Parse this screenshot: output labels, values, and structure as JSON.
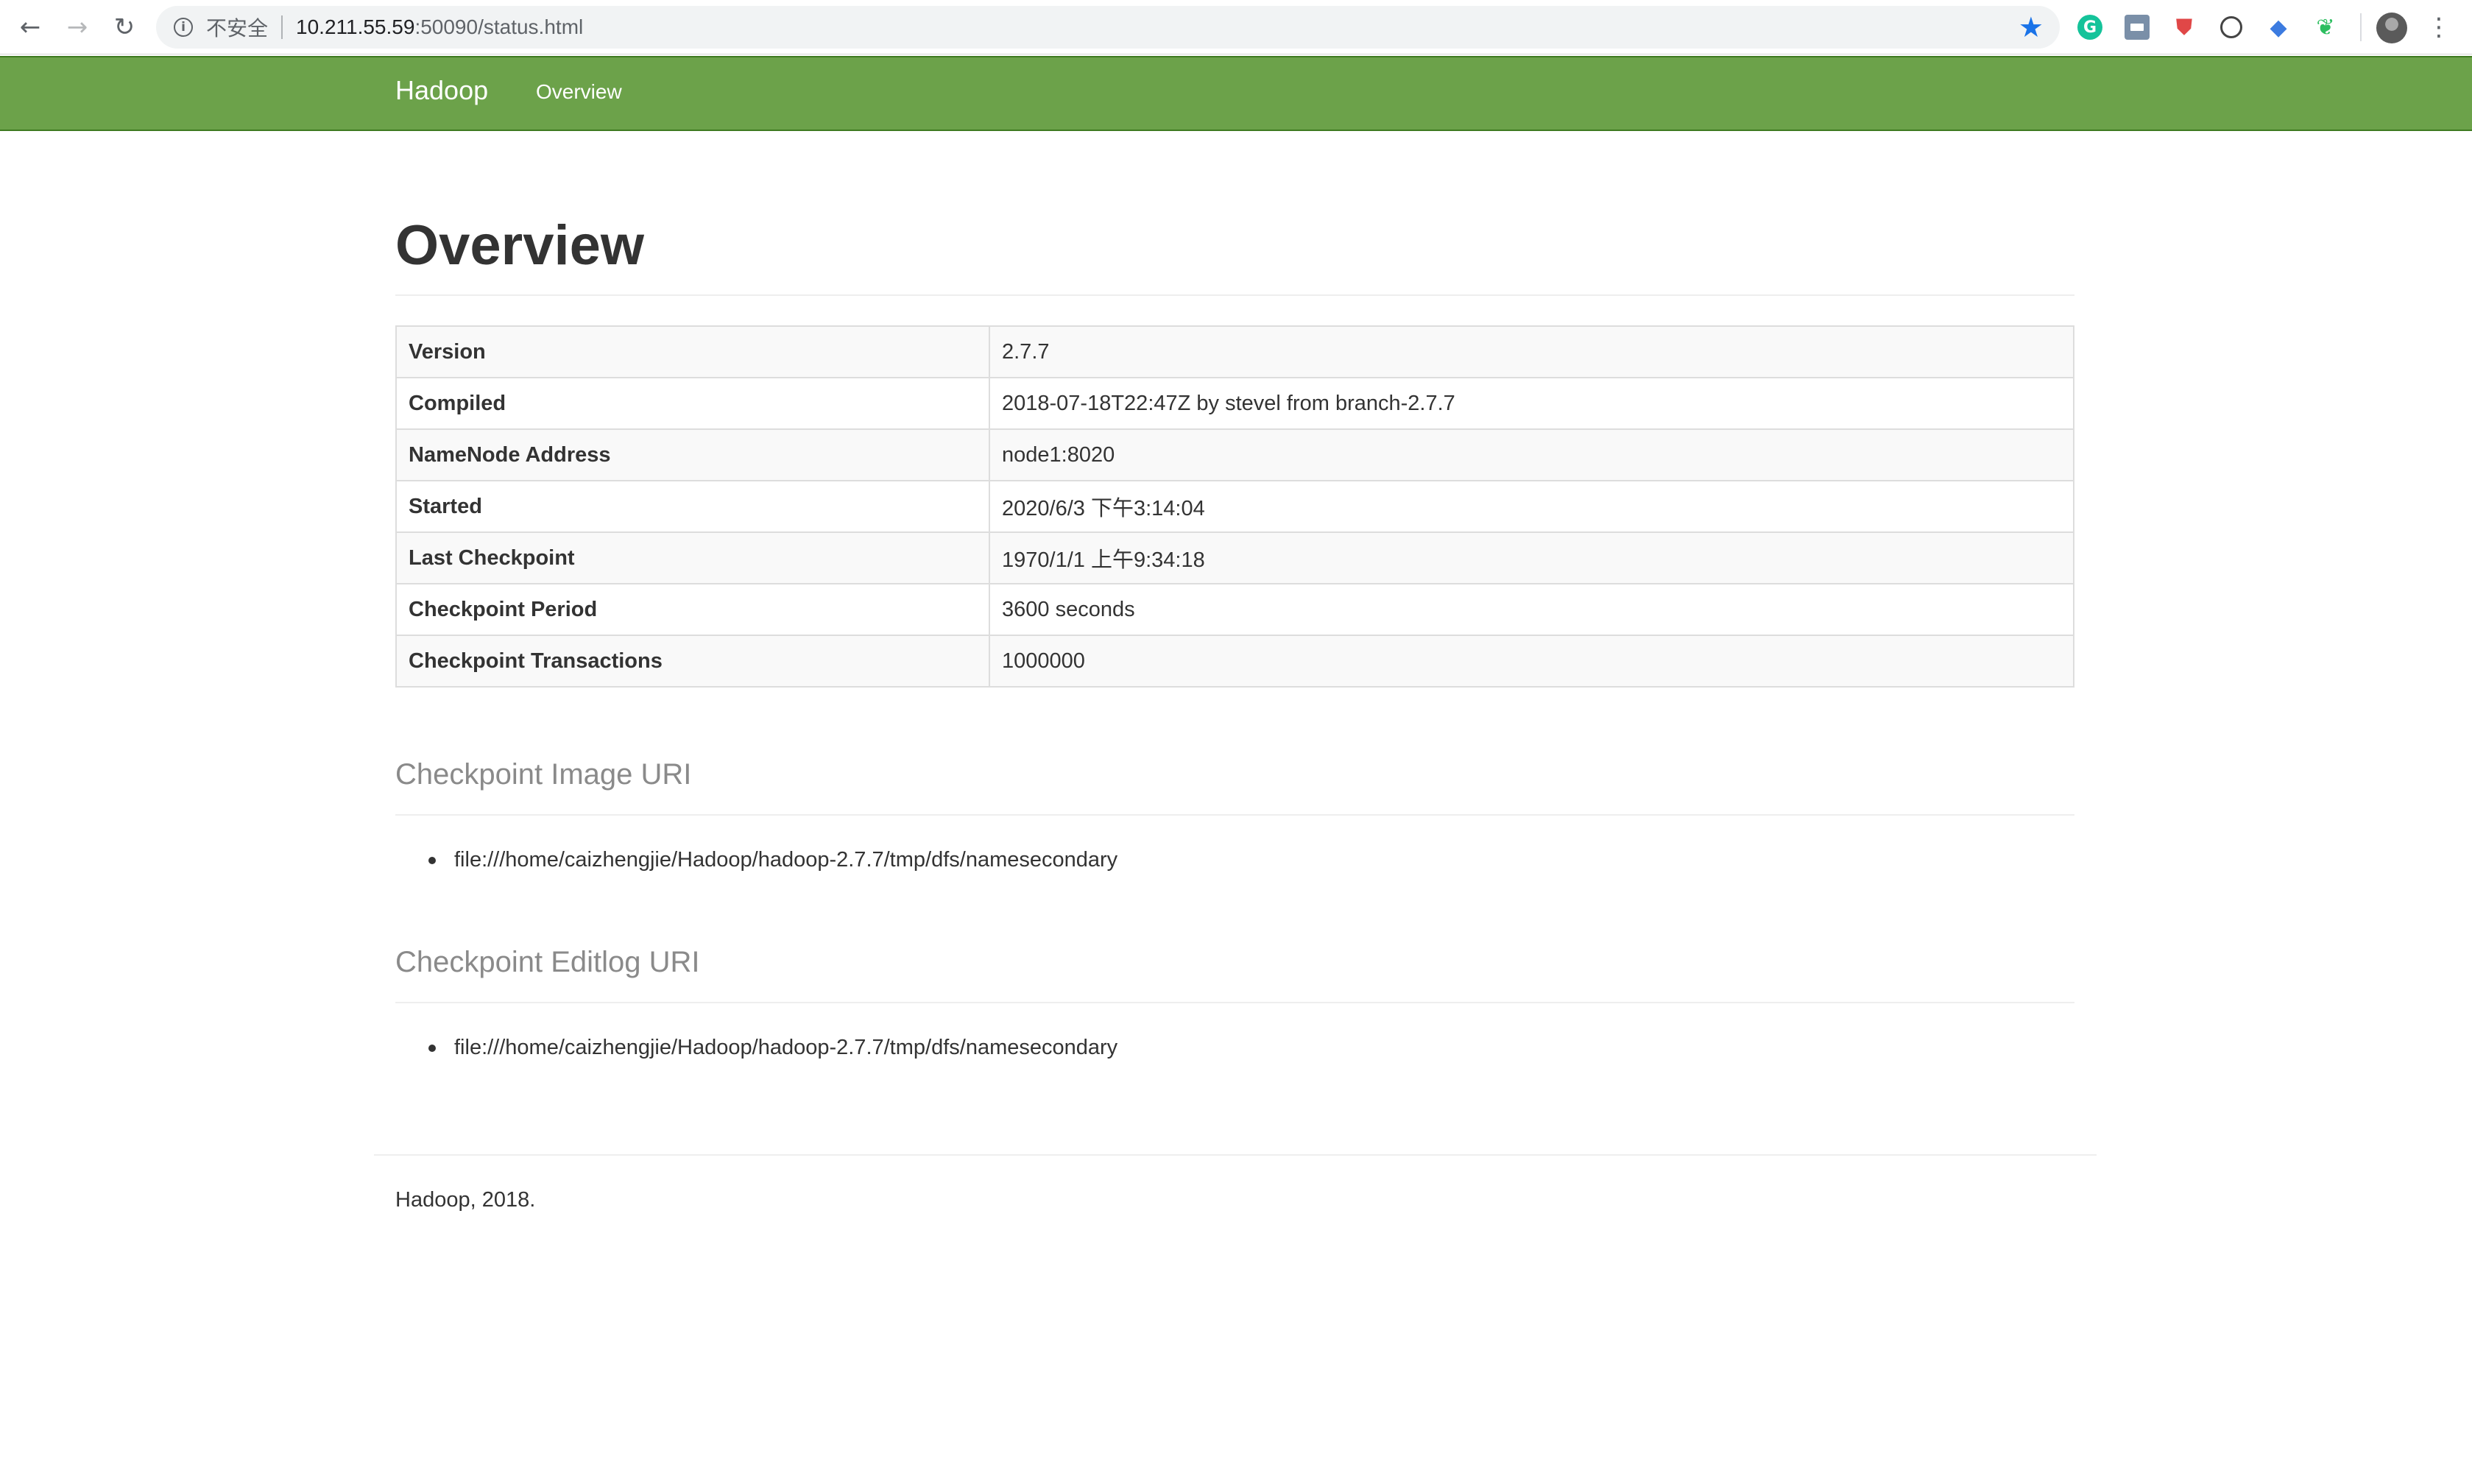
{
  "browser": {
    "back_icon": "←",
    "forward_icon": "→",
    "reload_icon": "↻",
    "info_icon": "i",
    "security_label": "不安全",
    "url_host": "10.211.55.59",
    "url_rest": ":50090/status.html",
    "star_icon": "★",
    "extensions": [
      {
        "name": "grammarly-icon",
        "glyph": "G"
      },
      {
        "name": "printer-icon",
        "glyph": ""
      },
      {
        "name": "shield-icon",
        "glyph": "⛊"
      },
      {
        "name": "gauge-icon",
        "glyph": ""
      },
      {
        "name": "graduation-cap-icon",
        "glyph": "◆"
      },
      {
        "name": "evernote-icon",
        "glyph": "❦"
      }
    ],
    "menu_icon": "⋮"
  },
  "navbar": {
    "brand": "Hadoop",
    "links": [
      "Overview"
    ],
    "background": "#6ca24a"
  },
  "overview": {
    "title": "Overview",
    "rows": [
      {
        "key": "Version",
        "value": "2.7.7"
      },
      {
        "key": "Compiled",
        "value": "2018-07-18T22:47Z by stevel from branch-2.7.7"
      },
      {
        "key": "NameNode Address",
        "value": "node1:8020"
      },
      {
        "key": "Started",
        "value": "2020/6/3 下午3:14:04"
      },
      {
        "key": "Last Checkpoint",
        "value": "1970/1/1 上午9:34:18"
      },
      {
        "key": "Checkpoint Period",
        "value": "3600 seconds"
      },
      {
        "key": "Checkpoint Transactions",
        "value": "1000000"
      }
    ]
  },
  "checkpoint_image": {
    "title": "Checkpoint Image URI",
    "uris": [
      "file:///home/caizhengjie/Hadoop/hadoop-2.7.7/tmp/dfs/namesecondary"
    ]
  },
  "checkpoint_editlog": {
    "title": "Checkpoint Editlog URI",
    "uris": [
      "file:///home/caizhengjie/Hadoop/hadoop-2.7.7/tmp/dfs/namesecondary"
    ]
  },
  "footer": {
    "text": "Hadoop, 2018."
  }
}
